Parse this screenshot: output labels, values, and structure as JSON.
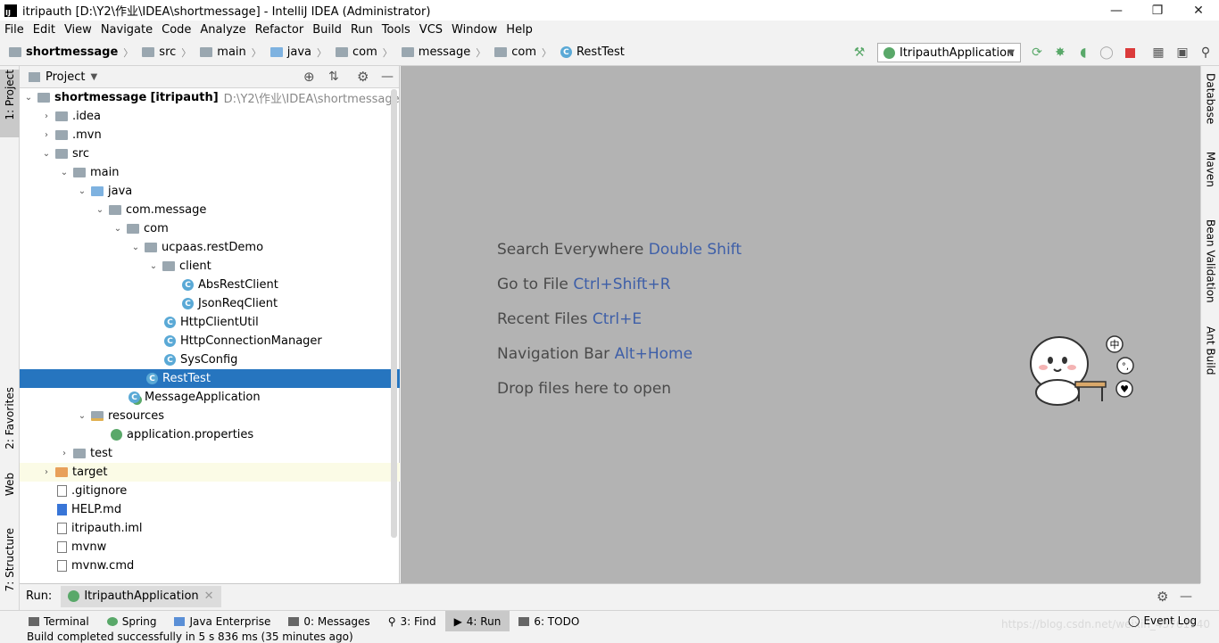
{
  "window": {
    "title": "itripauth [D:\\Y2\\作业\\IDEA\\shortmessage] - IntelliJ IDEA (Administrator)"
  },
  "menu": [
    "File",
    "Edit",
    "View",
    "Navigate",
    "Code",
    "Analyze",
    "Refactor",
    "Build",
    "Run",
    "Tools",
    "VCS",
    "Window",
    "Help"
  ],
  "breadcrumb": [
    "shortmessage",
    "src",
    "main",
    "java",
    "com",
    "message",
    "com",
    "RestTest"
  ],
  "run_config": "ItripauthApplication",
  "left_tabs": [
    "1: Project",
    "2: Favorites",
    "Web",
    "7: Structure"
  ],
  "right_tabs": [
    "Database",
    "Maven",
    "Bean Validation",
    "Ant Build"
  ],
  "project_panel": {
    "title": "Project",
    "root_name": "shortmessage",
    "root_module": "[itripauth]",
    "root_path": "D:\\Y2\\作业\\IDEA\\shortmessage",
    "items": [
      ".idea",
      ".mvn",
      "src",
      "main",
      "java",
      "com.message",
      "com",
      "ucpaas.restDemo",
      "client",
      "AbsRestClient",
      "JsonReqClient",
      "HttpClientUtil",
      "HttpConnectionManager",
      "SysConfig",
      "RestTest",
      "MessageApplication",
      "resources",
      "application.properties",
      "test",
      "target",
      ".gitignore",
      "HELP.md",
      "itripauth.iml",
      "mvnw",
      "mvnw.cmd"
    ]
  },
  "editor_hints": [
    {
      "text": "Search Everywhere",
      "key": "Double Shift"
    },
    {
      "text": "Go to File",
      "key": "Ctrl+Shift+R"
    },
    {
      "text": "Recent Files",
      "key": "Ctrl+E"
    },
    {
      "text": "Navigation Bar",
      "key": "Alt+Home"
    },
    {
      "text": "Drop files here to open",
      "key": ""
    }
  ],
  "run_panel": {
    "label": "Run:",
    "tab": "ItripauthApplication"
  },
  "bottom_tabs": [
    "Terminal",
    "Spring",
    "Java Enterprise",
    "0: Messages",
    "3: Find",
    "4: Run",
    "6: TODO"
  ],
  "event_log": "Event Log",
  "status": "Build completed successfully in 5 s 836 ms (35 minutes ago)",
  "watermark": "https://blog.csdn.net/weixin_43761940",
  "mascot_badges": [
    "中",
    "°,",
    "♥"
  ]
}
